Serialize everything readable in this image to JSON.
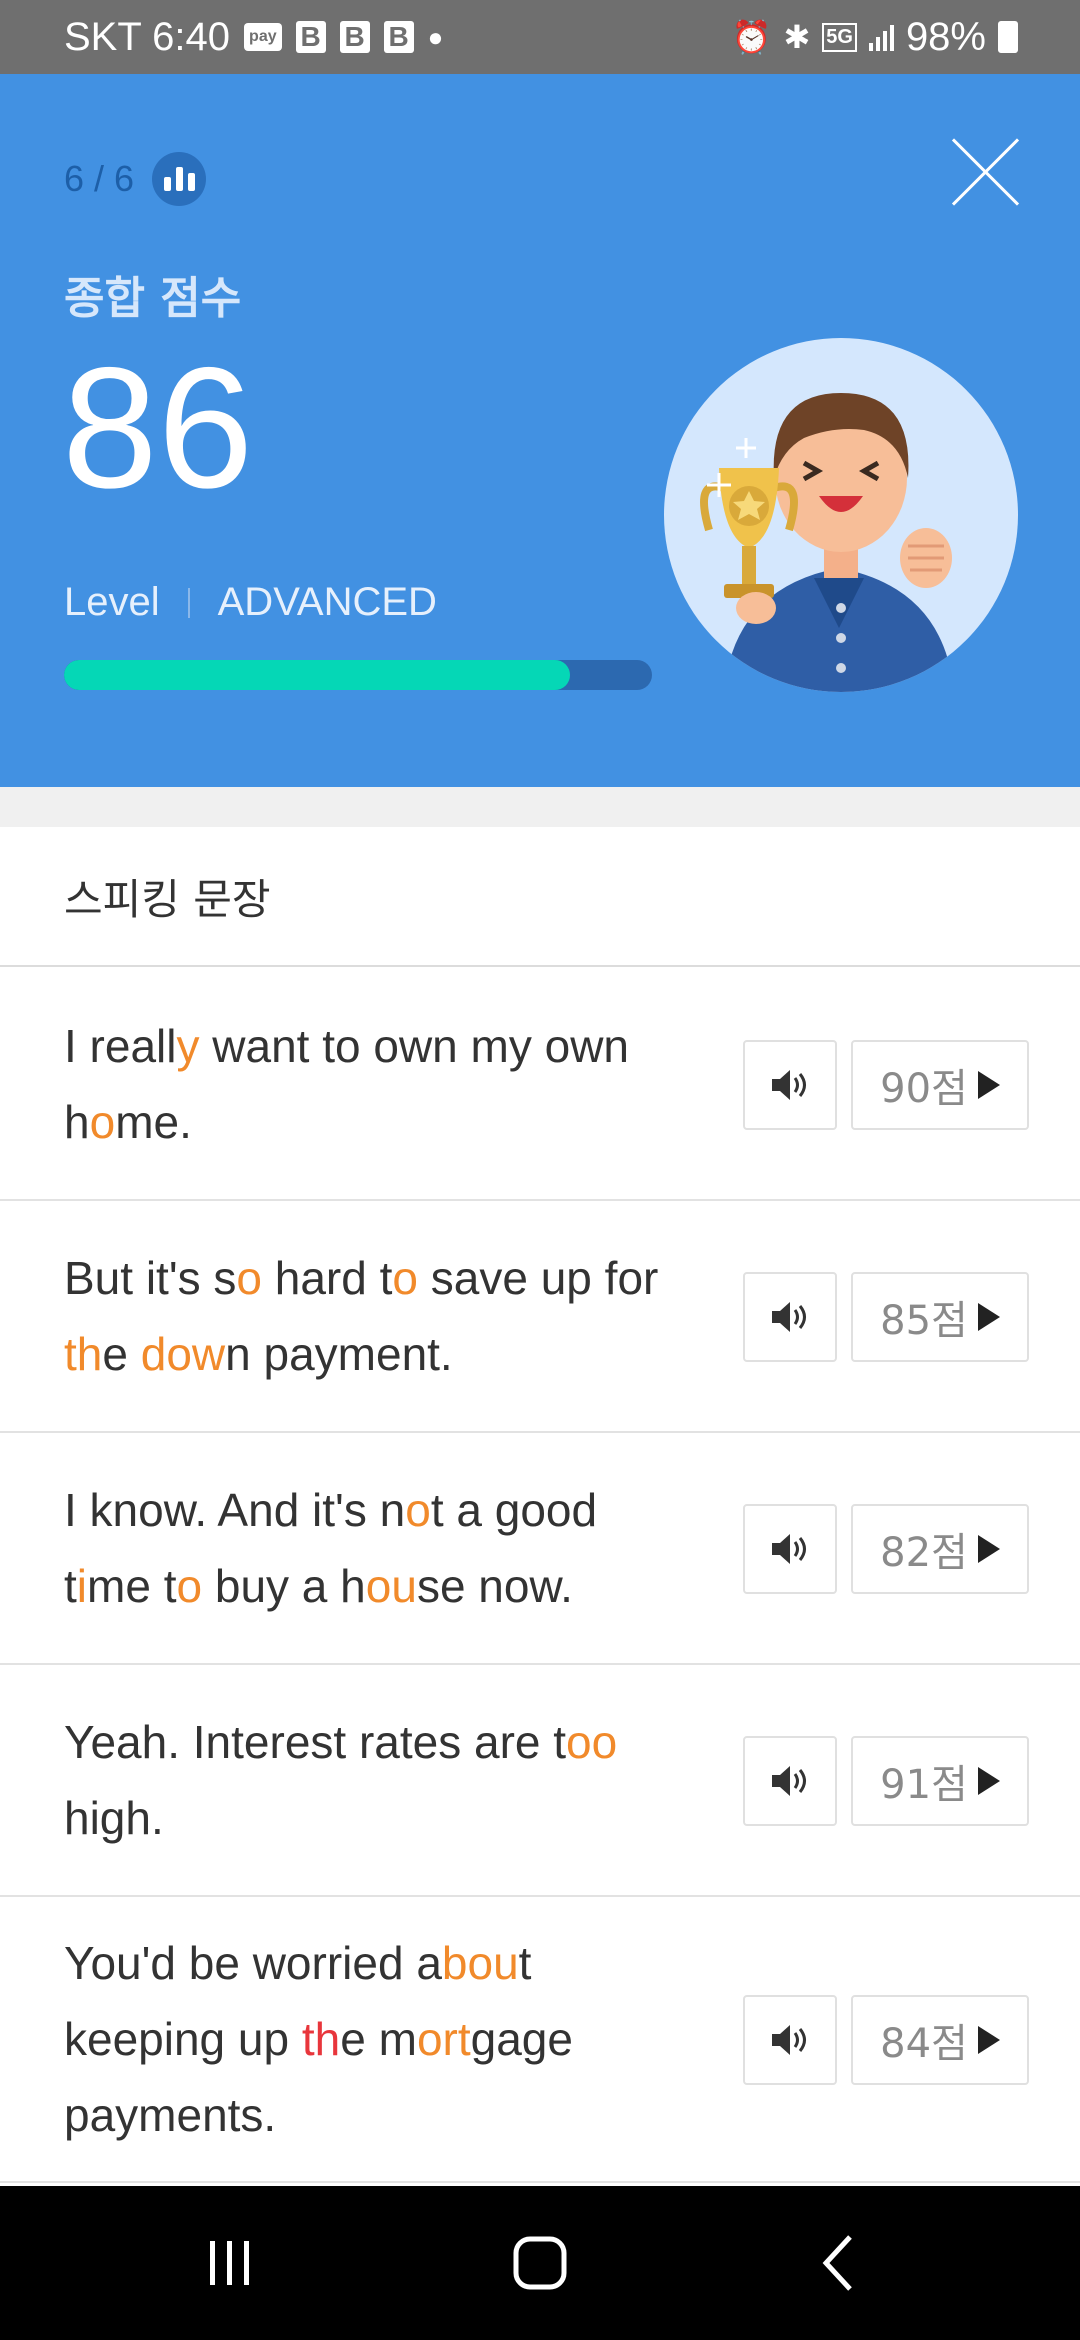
{
  "status_bar": {
    "carrier_time": "SKT 6:40",
    "pay_badge": "pay",
    "app_badge": "B",
    "network": "5G",
    "battery": "98%"
  },
  "header": {
    "progress": "6 / 6",
    "score_label": "종합 점수",
    "score": "86",
    "level_label": "Level",
    "level_value": "ADVANCED",
    "progress_fraction": 0.86
  },
  "section": {
    "title": "스피킹 문장"
  },
  "sentences": [
    {
      "segments": [
        {
          "t": "I reall",
          "c": ""
        },
        {
          "t": "y",
          "c": "o"
        },
        {
          "t": " want to own my own h",
          "c": ""
        },
        {
          "t": "o",
          "c": "o"
        },
        {
          "t": "me.",
          "c": ""
        }
      ],
      "score": "90점"
    },
    {
      "segments": [
        {
          "t": "But it's s",
          "c": ""
        },
        {
          "t": "o",
          "c": "o"
        },
        {
          "t": " hard t",
          "c": ""
        },
        {
          "t": "o",
          "c": "o"
        },
        {
          "t": " save up for ",
          "c": ""
        },
        {
          "t": "th",
          "c": "o"
        },
        {
          "t": "e ",
          "c": ""
        },
        {
          "t": "dow",
          "c": "o"
        },
        {
          "t": "n payment.",
          "c": ""
        }
      ],
      "score": "85점"
    },
    {
      "segments": [
        {
          "t": "I know. And it's n",
          "c": ""
        },
        {
          "t": "o",
          "c": "o"
        },
        {
          "t": "t a good t",
          "c": ""
        },
        {
          "t": "i",
          "c": "o"
        },
        {
          "t": "me t",
          "c": ""
        },
        {
          "t": "o",
          "c": "o"
        },
        {
          "t": " buy a h",
          "c": ""
        },
        {
          "t": "ou",
          "c": "o"
        },
        {
          "t": "se now.",
          "c": ""
        }
      ],
      "score": "82점"
    },
    {
      "segments": [
        {
          "t": "Yeah. Interest rates are t",
          "c": ""
        },
        {
          "t": "oo",
          "c": "o"
        },
        {
          "t": " high.",
          "c": ""
        }
      ],
      "score": "91점"
    },
    {
      "segments": [
        {
          "t": "You'd be worried a",
          "c": ""
        },
        {
          "t": "bou",
          "c": "o"
        },
        {
          "t": "t keeping up ",
          "c": ""
        },
        {
          "t": "th",
          "c": "r"
        },
        {
          "t": "e m",
          "c": ""
        },
        {
          "t": "ort",
          "c": "o"
        },
        {
          "t": "gage payments.",
          "c": ""
        }
      ],
      "score": "84점"
    }
  ],
  "icons": {
    "play": "speaker-icon",
    "score_arrow": "triangle-right-icon",
    "stats": "bar-chart-icon",
    "close": "close-icon"
  },
  "colors": {
    "header_bg": "#4291e2",
    "progress_fill": "#05d7b6",
    "highlight_orange": "#f18a2b",
    "highlight_red": "#e8363c"
  }
}
